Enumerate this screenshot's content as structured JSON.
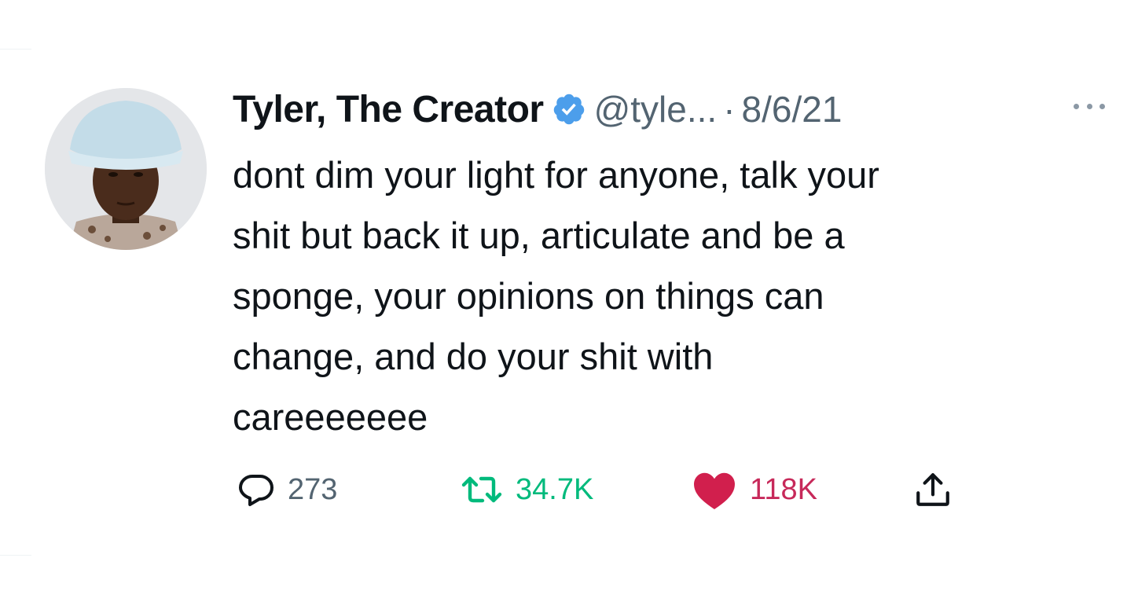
{
  "tweet": {
    "author": {
      "display_name": "Tyler, The Creator",
      "handle": "@tyle...",
      "verified": true,
      "avatar": "profile-photo"
    },
    "separator": "·",
    "date": "8/6/21",
    "text": "dont dim your light for anyone, talk your\nshit but back it up, articulate and be a\nsponge, your opinions on things can\nchange, and do your shit with\ncareeeeeee",
    "actions": {
      "reply": {
        "icon": "reply-icon",
        "count": "273"
      },
      "retweet": {
        "icon": "retweet-icon",
        "count": "34.7K"
      },
      "like": {
        "icon": "heart-icon",
        "count": "118K",
        "liked": true
      },
      "share": {
        "icon": "share-icon"
      }
    },
    "more_icon": "more-icon"
  },
  "colors": {
    "verified": "#4c9eeb",
    "retweet": "#00ba7c",
    "like": "#e0245e",
    "secondary_text": "#536471"
  }
}
